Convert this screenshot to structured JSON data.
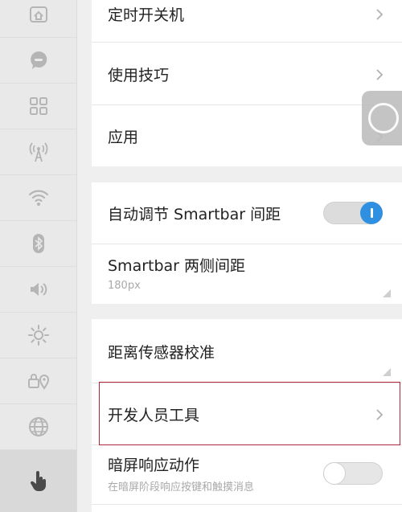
{
  "sidebar": {
    "items": [
      {
        "icon": "home-icon"
      },
      {
        "icon": "chat-bubble-icon"
      },
      {
        "icon": "grid-apps-icon"
      },
      {
        "icon": "hotspot-icon"
      },
      {
        "icon": "wifi-icon"
      },
      {
        "icon": "bluetooth-icon"
      },
      {
        "icon": "volume-icon"
      },
      {
        "icon": "brightness-icon"
      },
      {
        "icon": "lock-location-icon"
      },
      {
        "icon": "globe-icon"
      },
      {
        "icon": "hand-pointer-icon",
        "active": true
      }
    ]
  },
  "settings": {
    "scheduled_power": "定时开关机",
    "usage_tips": "使用技巧",
    "apps": "应用",
    "auto_adjust_smartbar": "自动调节 Smartbar 间距",
    "smartbar_side_spacing": "Smartbar 两侧间距",
    "smartbar_side_spacing_value": "180px",
    "proximity_calibration": "距离传感器校准",
    "developer_tools": "开发人员工具",
    "dark_screen_actions": "暗屏响应动作",
    "dark_screen_actions_desc": "在暗屏阶段响应按键和触摸消息"
  },
  "toggles": {
    "auto_adjust_smartbar": true,
    "dark_screen_actions": false
  },
  "colors": {
    "accent": "#2f8fe0",
    "highlight_border": "#b2263a"
  }
}
